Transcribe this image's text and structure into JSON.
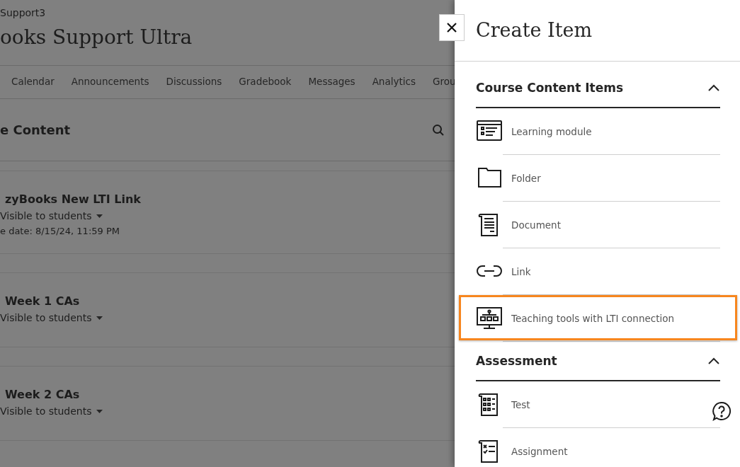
{
  "course": {
    "breadcrumb": "Support3",
    "title": "ooks Support Ultra"
  },
  "tabs": [
    {
      "label": "Calendar",
      "selected": false
    },
    {
      "label": "Announcements",
      "selected": false
    },
    {
      "label": "Discussions",
      "selected": false
    },
    {
      "label": "Gradebook",
      "selected": false
    },
    {
      "label": "Messages",
      "selected": false
    },
    {
      "label": "Analytics",
      "selected": false
    },
    {
      "label": "Grou",
      "selected": false
    }
  ],
  "content": {
    "heading": "e Content",
    "items": [
      {
        "title": "zyBooks New LTI Link",
        "visibility": "Visible to students",
        "due": "e date: 8/15/24, 11:59 PM"
      },
      {
        "title": "Week 1 CAs",
        "visibility": "Visible to students"
      },
      {
        "title": "Week 2 CAs",
        "visibility": "Visible to students"
      }
    ]
  },
  "panel": {
    "title": "Create Item",
    "sections": [
      {
        "title": "Course Content Items",
        "expanded": true,
        "items": [
          {
            "kind": "module",
            "label": "Learning module",
            "highlighted": false
          },
          {
            "kind": "folder",
            "label": "Folder",
            "highlighted": false
          },
          {
            "kind": "document",
            "label": "Document",
            "highlighted": false
          },
          {
            "kind": "link",
            "label": "Link",
            "highlighted": false
          },
          {
            "kind": "lti",
            "label": "Teaching tools with LTI connection",
            "highlighted": true
          }
        ]
      },
      {
        "title": "Assessment",
        "expanded": true,
        "items": [
          {
            "kind": "test",
            "label": "Test",
            "highlighted": false
          },
          {
            "kind": "assignment",
            "label": "Assignment",
            "highlighted": false
          }
        ]
      }
    ]
  }
}
